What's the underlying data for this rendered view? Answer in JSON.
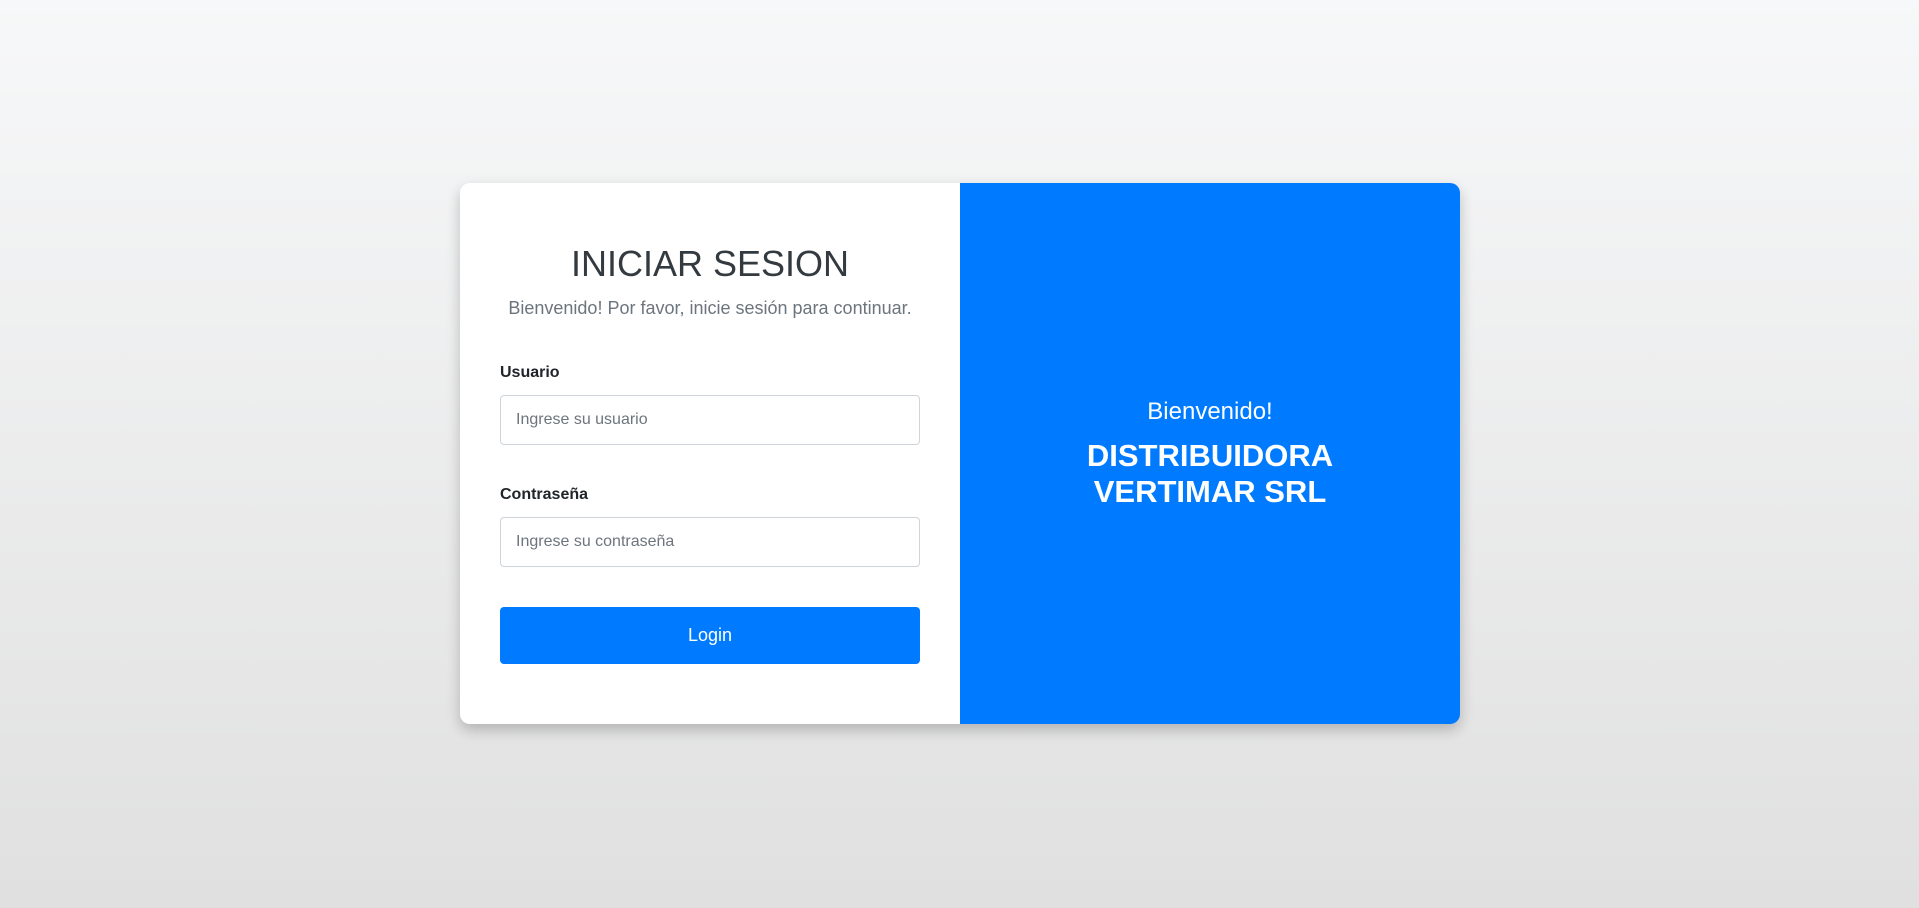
{
  "login": {
    "title": "INICIAR SESION",
    "subtitle": "Bienvenido! Por favor, inicie sesión para continuar.",
    "username_label": "Usuario",
    "username_placeholder": "Ingrese su usuario",
    "username_value": "",
    "password_label": "Contraseña",
    "password_placeholder": "Ingrese su contraseña",
    "password_value": "",
    "button_label": "Login"
  },
  "banner": {
    "welcome": "Bienvenido!",
    "company": "DISTRIBUIDORA VERTIMAR SRL",
    "background_color": "#007bff"
  },
  "colors": {
    "accent": "#007bff",
    "card_background": "#ffffff",
    "title_text": "#333a40",
    "muted_text": "#6c757d"
  }
}
